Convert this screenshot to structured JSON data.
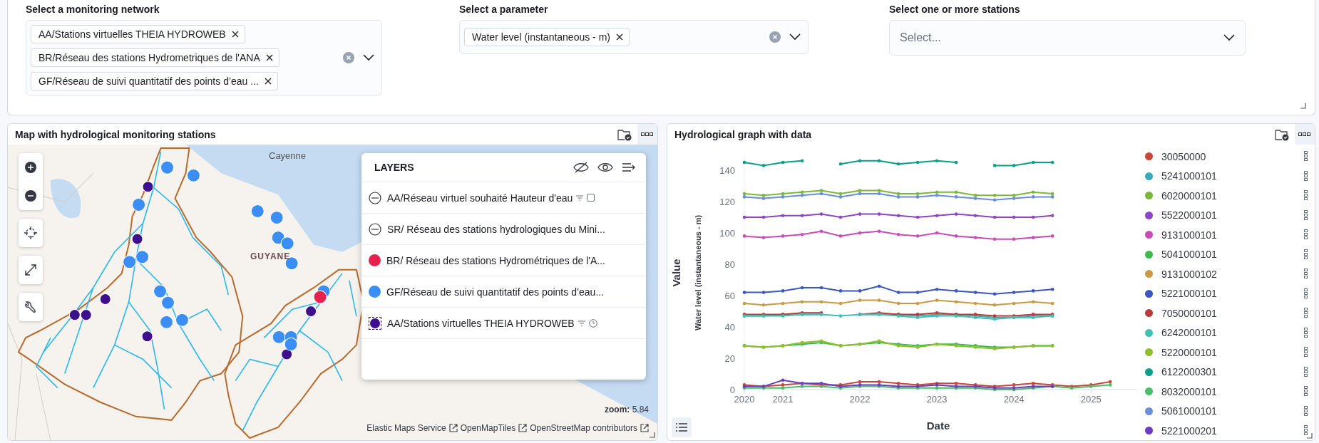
{
  "filters": [
    {
      "label": "Select a monitoring network",
      "kind": "chips",
      "clearable": true,
      "chips": [
        "AA/Stations virtuelles THEIA HYDROWEB",
        "BR/Réseau des stations Hydrometriques de l'ANA",
        "GF/Réseau de suivi quantitatif des points d’eau ..."
      ]
    },
    {
      "label": "Select a parameter",
      "kind": "chips",
      "clearable": true,
      "chips": [
        "Water level (instantaneous - m)"
      ]
    },
    {
      "label": "Select one or more stations",
      "kind": "placeholder",
      "clearable": false,
      "placeholder": "Select..."
    }
  ],
  "map_panel": {
    "title": "Map with hydrological monitoring stations",
    "place_labels": [
      {
        "text": "Cayenne",
        "kind": "city"
      },
      {
        "text": "GUYANE",
        "kind": "region"
      }
    ],
    "layers_panel": {
      "title": "LAYERS",
      "layers": [
        {
          "label": "AA/Réseau virtuel souhaité Hauteur d'eau",
          "kind": "hidden",
          "filter": true,
          "checkbox": true,
          "clock": false
        },
        {
          "label": "SR/ Réseau des stations hydrologiques du Mini...",
          "kind": "hidden",
          "filter": false,
          "checkbox": false,
          "clock": false
        },
        {
          "label": "BR/ Réseau des stations Hydrométriques de l'A...",
          "kind": "dot",
          "color": "#e7204f",
          "filter": false,
          "checkbox": false,
          "clock": false
        },
        {
          "label": "GF/Réseau de suivi quantitatif des points d’eau...",
          "kind": "dot",
          "color": "#3b8ef5",
          "filter": false,
          "checkbox": false,
          "clock": false
        },
        {
          "label": "AA/Stations virtuelles THEIA HYDROWEB",
          "kind": "boxed",
          "color": "#3d0f8c",
          "filter": true,
          "checkbox": false,
          "clock": true
        }
      ]
    },
    "zoom_label": "zoom:",
    "zoom_value": "5.84",
    "attributions": [
      "Elastic Maps Service",
      "OpenMapTiles",
      "OpenStreetMap contributors"
    ]
  },
  "chart_panel": {
    "title": "Hydrological graph with data",
    "y_unit_label": "Water level (instantaneous - m)",
    "chart_data": {
      "type": "line",
      "xlabel": "Date",
      "ylabel": "Value",
      "x": [
        2020.5,
        2020.75,
        2021,
        2021.25,
        2021.5,
        2021.75,
        2022,
        2022.25,
        2022.5,
        2022.75,
        2023,
        2023.25,
        2023.5,
        2023.75,
        2024,
        2024.25,
        2024.5,
        2024.75,
        2025,
        2025.25
      ],
      "xlim": [
        2020.5,
        2025.6
      ],
      "ylim": [
        0,
        150
      ],
      "xticks": [
        {
          "value": 2020.5,
          "label": "2020"
        },
        2021,
        2022,
        2023,
        2024,
        2025
      ],
      "yticks": [
        0,
        20,
        40,
        60,
        80,
        100,
        120,
        140
      ],
      "series": [
        {
          "name": "30050000",
          "color": "#c8453a",
          "values": [
            3,
            2,
            3,
            4,
            3,
            3,
            5,
            5,
            4,
            3,
            4,
            4,
            3,
            2,
            3,
            4,
            3,
            2,
            3,
            5
          ]
        },
        {
          "name": "5241000101",
          "color": "#3aa9b8",
          "values": [
            47,
            47,
            48,
            48,
            48,
            null,
            48,
            48,
            48,
            47,
            48,
            48,
            47,
            46,
            46,
            47,
            47,
            null,
            null,
            null
          ]
        },
        {
          "name": "6020000101",
          "color": "#7ab83a",
          "values": [
            125,
            124,
            125,
            126,
            127,
            125,
            127,
            127,
            125,
            125,
            126,
            126,
            124,
            124,
            124,
            126,
            125,
            null,
            null,
            null
          ]
        },
        {
          "name": "5522000101",
          "color": "#8e44c8",
          "values": [
            110,
            110,
            111,
            111,
            112,
            110,
            112,
            112,
            111,
            110,
            111,
            112,
            111,
            110,
            110,
            110,
            111,
            null,
            null,
            null
          ]
        },
        {
          "name": "9131000101",
          "color": "#c84bb8",
          "values": [
            98,
            97,
            98,
            99,
            101,
            98,
            100,
            101,
            99,
            98,
            100,
            98,
            97,
            96,
            96,
            97,
            98,
            null,
            null,
            null
          ]
        },
        {
          "name": "5041000101",
          "color": "#3cb94f",
          "values": [
            28,
            27,
            28,
            29,
            30,
            28,
            29,
            30,
            29,
            28,
            29,
            29,
            28,
            27,
            27,
            28,
            28,
            null,
            null,
            null
          ]
        },
        {
          "name": "9131000102",
          "color": "#c99a45",
          "values": [
            55,
            54,
            55,
            56,
            56,
            55,
            57,
            57,
            55,
            55,
            57,
            56,
            55,
            54,
            55,
            56,
            55,
            null,
            null,
            null
          ]
        },
        {
          "name": "5221000101",
          "color": "#3a56c0",
          "values": [
            62,
            62,
            63,
            65,
            65,
            63,
            63,
            66,
            62,
            62,
            64,
            63,
            62,
            61,
            62,
            63,
            64,
            null,
            null,
            null
          ]
        },
        {
          "name": "7050000101",
          "color": "#b83c3c",
          "values": [
            48,
            48,
            48,
            49,
            49,
            null,
            48,
            49,
            48,
            48,
            49,
            48,
            48,
            47,
            47,
            48,
            48,
            null,
            null,
            null
          ]
        },
        {
          "name": "6242000101",
          "color": "#40bfb4",
          "values": [
            47,
            47,
            47,
            48,
            48,
            47,
            48,
            48,
            47,
            46,
            47,
            47,
            46,
            45,
            46,
            46,
            47,
            null,
            null,
            null
          ]
        },
        {
          "name": "5220000101",
          "color": "#8fbe2e",
          "values": [
            28,
            27,
            28,
            30,
            31,
            28,
            29,
            31,
            28,
            27,
            29,
            28,
            27,
            26,
            27,
            28,
            28,
            null,
            null,
            null
          ]
        },
        {
          "name": "6122000301",
          "color": "#0d9e8a",
          "values": [
            145,
            143,
            145,
            146,
            null,
            144,
            146,
            146,
            144,
            145,
            146,
            145,
            null,
            143,
            143,
            145,
            145,
            null,
            null,
            null
          ]
        },
        {
          "name": "8032000101",
          "color": "#4cbc6a",
          "values": [
            1,
            1,
            1,
            2,
            2,
            1,
            2,
            2,
            1,
            1,
            1,
            1,
            1,
            0,
            0,
            1,
            2,
            1,
            2,
            3
          ]
        },
        {
          "name": "5061000101",
          "color": "#6a8ddc",
          "values": [
            123,
            122,
            123,
            124,
            125,
            123,
            125,
            125,
            123,
            123,
            124,
            123,
            122,
            121,
            122,
            123,
            123,
            null,
            null,
            null
          ]
        },
        {
          "name": "5221000201",
          "color": "#6b3cc0",
          "values": [
            2,
            2,
            6,
            4,
            4,
            2,
            3,
            3,
            2,
            2,
            3,
            2,
            2,
            1,
            1,
            2,
            2,
            null,
            null,
            null
          ]
        }
      ]
    }
  }
}
